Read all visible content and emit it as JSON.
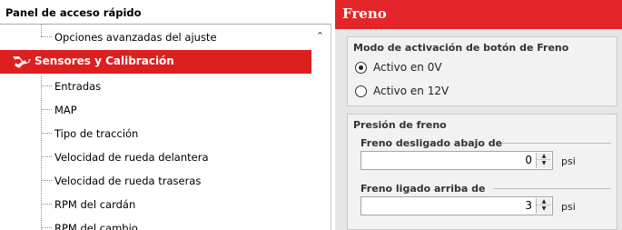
{
  "quick_panel": {
    "title": "Panel de acceso rápido",
    "items_above": [
      {
        "label": "Opciones avanzadas del ajuste"
      }
    ],
    "category": {
      "label": "Sensores y Calibración",
      "icon": "sensor-calibration-icon",
      "color": "#dc2020"
    },
    "items": [
      {
        "label": "Entradas"
      },
      {
        "label": "MAP"
      },
      {
        "label": "Tipo de tracción"
      },
      {
        "label": "Velocidad de rueda delantera"
      },
      {
        "label": "Velocidad de rueda traseras"
      },
      {
        "label": "RPM del cardán"
      },
      {
        "label": "RPM del cambio"
      }
    ]
  },
  "freno": {
    "title": "Freno",
    "header_color": "#e3262a",
    "mode_group": {
      "title": "Modo de activación de botón de Freno",
      "options": [
        {
          "label": "Activo en 0V",
          "selected": true
        },
        {
          "label": "Activo en 12V",
          "selected": false
        }
      ]
    },
    "pressure_group": {
      "title": "Presión de freno",
      "fields": [
        {
          "label": "Freno desligado abajo de",
          "value": "0",
          "unit": "psi"
        },
        {
          "label": "Freno ligado arriba de",
          "value": "3",
          "unit": "psi"
        }
      ]
    }
  }
}
